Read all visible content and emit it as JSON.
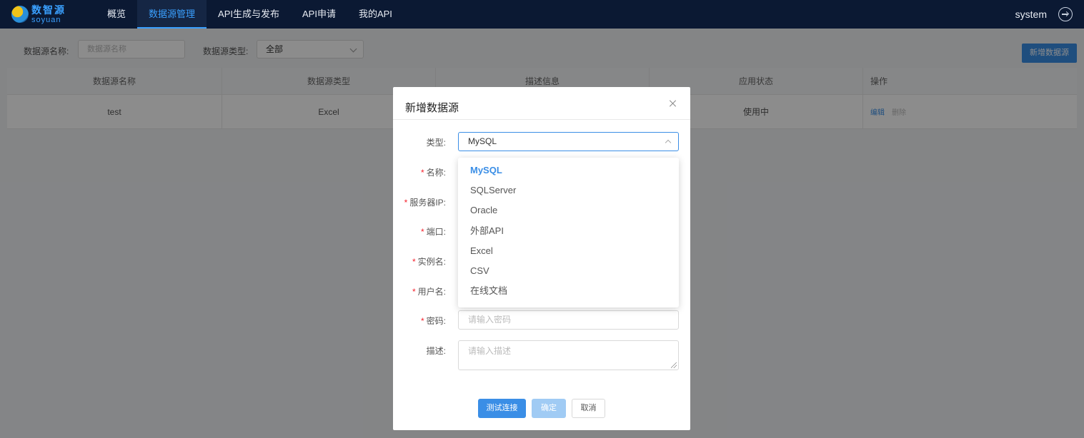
{
  "app": {
    "logo_cn": "数智源",
    "logo_en": "soyuan"
  },
  "nav": {
    "items": [
      {
        "label": "概览"
      },
      {
        "label": "数据源管理",
        "active": true
      },
      {
        "label": "API生成与发布"
      },
      {
        "label": "API申请"
      },
      {
        "label": "我的API"
      }
    ],
    "user": "system"
  },
  "filters": {
    "name_label": "数据源名称:",
    "name_placeholder": "数据源名称",
    "type_label": "数据源类型:",
    "type_value": "全部",
    "add_button": "新增数据源"
  },
  "table": {
    "headers": [
      "数据源名称",
      "数据源类型",
      "描述信息",
      "应用状态",
      "操作"
    ],
    "rows": [
      {
        "name": "test",
        "type": "Excel",
        "desc": "",
        "status": "使用中",
        "edit": "编辑",
        "delete": "删除"
      }
    ]
  },
  "modal": {
    "title": "新增数据源",
    "labels": {
      "type": "类型:",
      "name": "名称:",
      "server_ip": "服务器IP:",
      "port": "端口:",
      "instance": "实例名:",
      "username": "用户名:",
      "password": "密码:",
      "description": "描述:"
    },
    "type_value": "MySQL",
    "password_placeholder": "请输入密码",
    "description_placeholder": "请输入描述",
    "dropdown_options": [
      "MySQL",
      "SQLServer",
      "Oracle",
      "外部API",
      "Excel",
      "CSV",
      "在线文档"
    ],
    "buttons": {
      "test": "测试连接",
      "ok": "确定",
      "cancel": "取消"
    }
  },
  "colors": {
    "accent": "#3a8ee6",
    "nav_bg": "#0b1933",
    "required": "#f5222d"
  }
}
